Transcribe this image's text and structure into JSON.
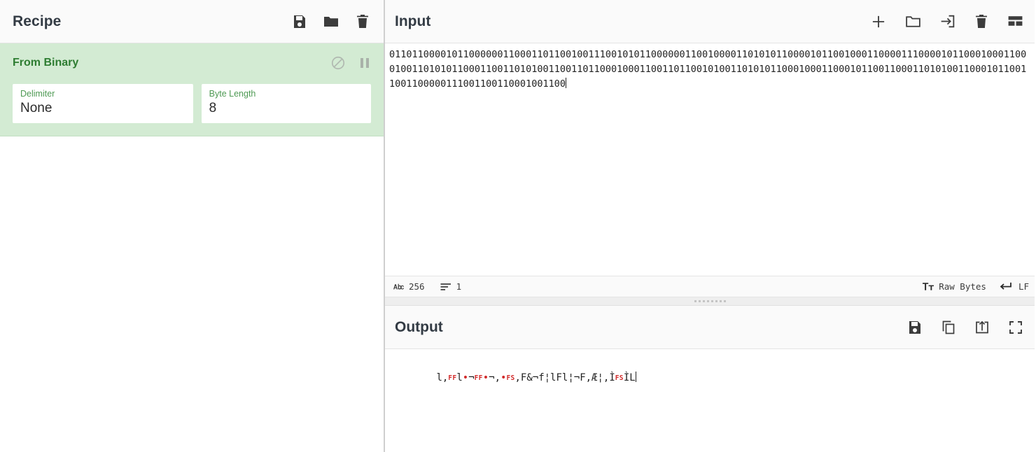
{
  "recipe": {
    "title": "Recipe",
    "tools": [
      {
        "name": "save-recipe-button",
        "icon": "save-icon",
        "label": "Save recipe"
      },
      {
        "name": "load-recipe-button",
        "icon": "folder-icon",
        "label": "Load recipe"
      },
      {
        "name": "clear-recipe-button",
        "icon": "trash-icon",
        "label": "Clear recipe"
      }
    ],
    "operation": {
      "title": "From Binary",
      "disable_label": "Disable operation",
      "pause_label": "Set breakpoint",
      "args": [
        {
          "label": "Delimiter",
          "value": "None"
        },
        {
          "label": "Byte Length",
          "value": "8"
        }
      ]
    }
  },
  "input": {
    "title": "Input",
    "tools": [
      {
        "name": "add-input-tab-button",
        "icon": "plus-icon",
        "label": "Add a new input"
      },
      {
        "name": "open-file-button",
        "icon": "folder-icon",
        "label": "Open file as input"
      },
      {
        "name": "open-folder-button",
        "icon": "import-icon",
        "label": "Open folder as input"
      },
      {
        "name": "clear-input-button",
        "icon": "trash-icon",
        "label": "Clear input and output"
      },
      {
        "name": "reset-pane-layout-button",
        "icon": "layout-icon",
        "label": "Reset pane layout"
      }
    ],
    "text": "011011000010110000001100011011001001110010101100000011001000011010101100001011001000110000111000010110001000110001001101010110001100110101001100110110001000110011011001010011010101100010001100010110011000110101001100010110011001100000111001100110001001100",
    "status": {
      "length_icon": "abc-icon",
      "length": "256",
      "lines_icon": "lines-icon",
      "lines": "1",
      "encoding_icon": "font-icon",
      "encoding": "Raw Bytes",
      "eol_icon": "return-icon",
      "eol": "LF"
    }
  },
  "output": {
    "title": "Output",
    "tools": [
      {
        "name": "save-output-button",
        "icon": "save-icon",
        "label": "Save output to file"
      },
      {
        "name": "copy-output-button",
        "icon": "copy-icon",
        "label": "Copy raw output to the clipboard"
      },
      {
        "name": "replace-input-button",
        "icon": "bake-to-input-icon",
        "label": "Replace input with output"
      },
      {
        "name": "maximise-output-button",
        "icon": "fullscreen-icon",
        "label": "Maximise output pane"
      }
    ],
    "segments": [
      {
        "kind": "text",
        "value": "l,"
      },
      {
        "kind": "ctrl",
        "value": "FF"
      },
      {
        "kind": "text",
        "value": "l"
      },
      {
        "kind": "dot",
        "value": "•"
      },
      {
        "kind": "text",
        "value": "¬"
      },
      {
        "kind": "ctrl",
        "value": "FF"
      },
      {
        "kind": "dot",
        "value": "•"
      },
      {
        "kind": "text",
        "value": "¬,"
      },
      {
        "kind": "dot",
        "value": "•"
      },
      {
        "kind": "ctrl",
        "value": "FS"
      },
      {
        "kind": "text",
        "value": ",F&¬f¦lFl¦¬F,Æ¦,Ì"
      },
      {
        "kind": "ctrl",
        "value": "FS"
      },
      {
        "kind": "text",
        "value": "ÌL"
      }
    ]
  }
}
